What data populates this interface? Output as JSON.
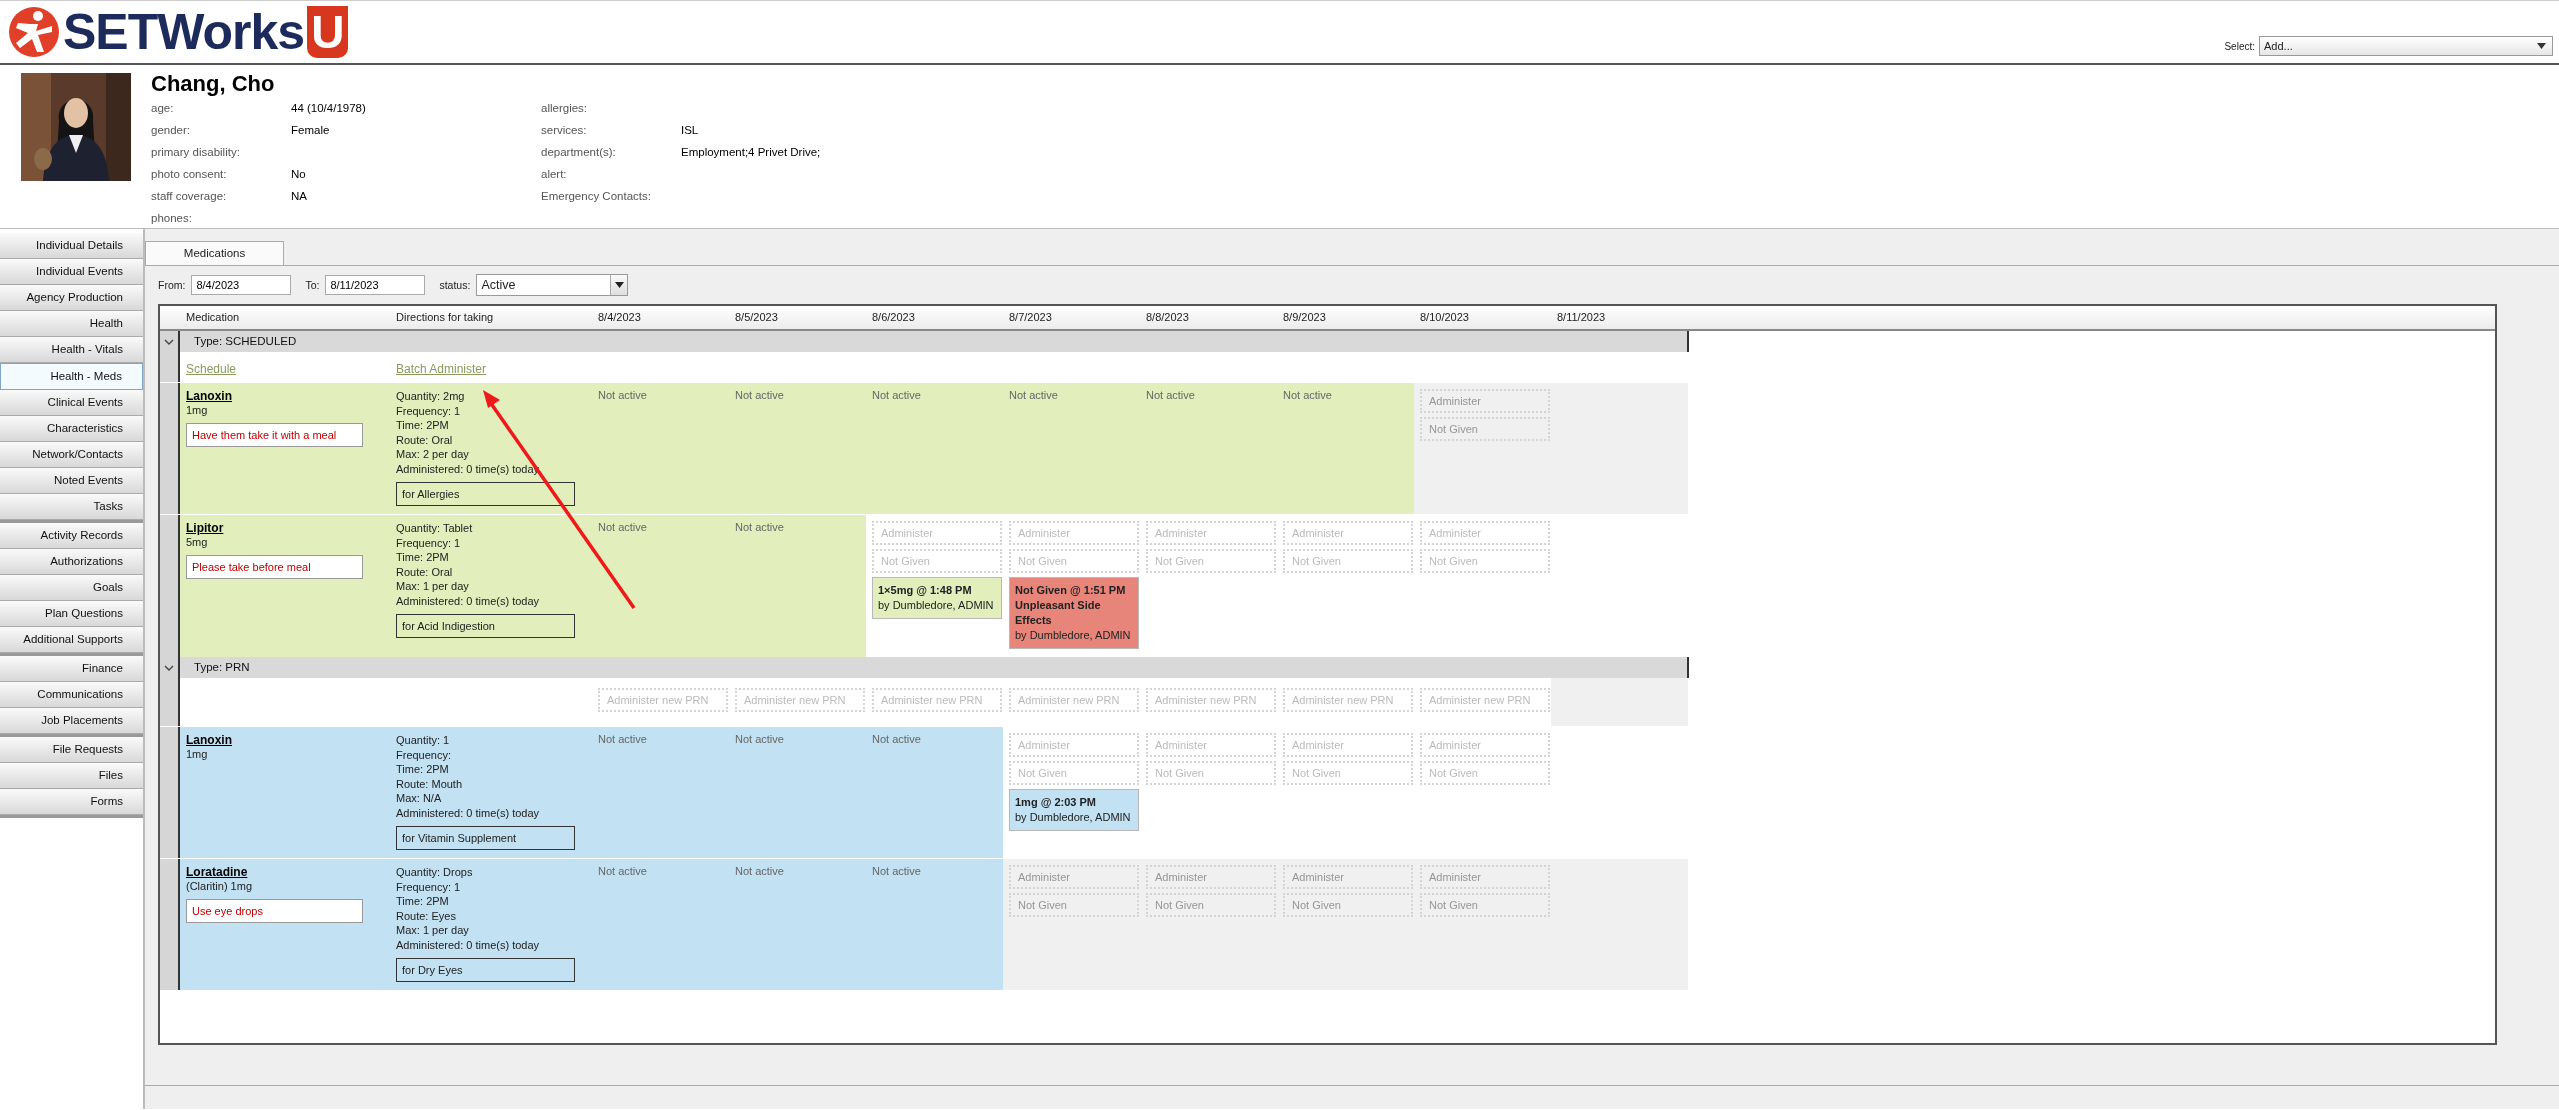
{
  "logo": {
    "text": "SETWorks",
    "badge": "U"
  },
  "top_select": {
    "label": "Select:",
    "value": "Add..."
  },
  "profile": {
    "name": "Chang, Cho",
    "fields_left": [
      {
        "label": "age:",
        "value": "44 (10/4/1978)"
      },
      {
        "label": "gender:",
        "value": "Female"
      },
      {
        "label": "primary disability:"
      },
      {
        "label": "photo consent:",
        "value": "No"
      },
      {
        "label": "staff coverage:",
        "value": "NA"
      },
      {
        "label": "phones:"
      }
    ],
    "fields_right": [
      {
        "label": "allergies:"
      },
      {
        "label": "services:",
        "value": "ISL"
      },
      {
        "label": "department(s):",
        "value": "Employment;4 Privet Drive;"
      },
      {
        "label": "alert:"
      },
      {
        "label": "Emergency Contacts:"
      }
    ]
  },
  "sidebar": {
    "groups": [
      {
        "items": [
          {
            "label": "Individual Details",
            "selected": false
          },
          {
            "label": "Individual Events",
            "selected": false
          },
          {
            "label": "Agency Production",
            "selected": false
          },
          {
            "label": "Health",
            "selected": false
          },
          {
            "label": "Health - Vitals",
            "selected": false
          },
          {
            "label": "Health - Meds",
            "selected": true
          },
          {
            "label": "Clinical Events",
            "selected": false
          },
          {
            "label": "Characteristics",
            "selected": false
          },
          {
            "label": "Network/Contacts",
            "selected": false
          },
          {
            "label": "Noted Events",
            "selected": false
          },
          {
            "label": "Tasks",
            "selected": false
          }
        ]
      },
      {
        "items": [
          {
            "label": "Activity Records",
            "selected": false
          },
          {
            "label": "Authorizations",
            "selected": false
          },
          {
            "label": "Goals",
            "selected": false
          },
          {
            "label": "Plan Questions",
            "selected": false
          },
          {
            "label": "Additional Supports",
            "selected": false
          }
        ]
      },
      {
        "items": [
          {
            "label": "Finance",
            "selected": false
          },
          {
            "label": "Communications",
            "selected": false
          },
          {
            "label": "Job Placements",
            "selected": false
          }
        ]
      },
      {
        "items": [
          {
            "label": "File Requests",
            "selected": false
          },
          {
            "label": "Files",
            "selected": false
          },
          {
            "label": "Forms",
            "selected": false
          }
        ]
      }
    ]
  },
  "tabs": [
    {
      "label": "Medications",
      "selected": true
    }
  ],
  "filters": {
    "from": {
      "label": "From:",
      "value": "8/4/2023"
    },
    "to": {
      "label": "To:",
      "value": "8/11/2023"
    },
    "status": {
      "label": "status:",
      "value": "Active"
    }
  },
  "table": {
    "columns": [
      "Medication",
      "Directions for taking",
      "8/4/2023",
      "8/5/2023",
      "8/6/2023",
      "8/7/2023",
      "8/8/2023",
      "8/9/2023",
      "8/10/2023",
      "8/11/2023"
    ],
    "groups": [
      {
        "kind": "scheduled",
        "title": "Type: SCHEDULED",
        "expanded": true,
        "extra": {
          "kind": "links",
          "links": [
            "Schedule",
            "Batch Administer"
          ]
        },
        "rows": [
          {
            "name": "Lanoxin",
            "strength": "1mg",
            "note": "Have them take it with a meal",
            "directions": [
              "Quantity: 2mg",
              "Frequency: 1",
              "Time: 2PM",
              "Route: Oral",
              "Max: 2 per day",
              "Administered: 0 time(s) today"
            ],
            "purpose": "for Allergies",
            "days": [
              {
                "kind": "not_active",
                "text": "Not active"
              },
              {
                "kind": "not_active",
                "text": "Not active"
              },
              {
                "kind": "not_active",
                "text": "Not active"
              },
              {
                "kind": "not_active",
                "text": "Not active"
              },
              {
                "kind": "not_active",
                "text": "Not active"
              },
              {
                "kind": "not_active",
                "text": "Not active"
              },
              {
                "kind": "actions",
                "disabled": true,
                "buttons": [
                  "Administer",
                  "Not Given"
                ]
              },
              {
                "kind": "blank",
                "disabled": true
              }
            ]
          },
          {
            "name": "Lipitor",
            "strength": "5mg",
            "note": "Please take before meal",
            "directions": [
              "Quantity: Tablet",
              "Frequency: 1",
              "Time: 2PM",
              "Route: Oral",
              "Max: 1 per day",
              "Administered: 0 time(s) today"
            ],
            "purpose": "for Acid Indigestion",
            "days": [
              {
                "kind": "not_active",
                "text": "Not active"
              },
              {
                "kind": "not_active",
                "text": "Not active"
              },
              {
                "kind": "actions",
                "disabled": false,
                "buttons": [
                  "Administer",
                  "Not Given"
                ],
                "record": {
                  "kind": "given",
                  "heading": [
                    "1×5mg @ 1:48 PM"
                  ],
                  "by": "by Dumbledore, ADMIN"
                }
              },
              {
                "kind": "actions",
                "disabled": false,
                "buttons": [
                  "Administer",
                  "Not Given"
                ],
                "record": {
                  "kind": "not_given",
                  "heading": [
                    "Not Given @ 1:51 PM",
                    "Unpleasant Side Effects"
                  ],
                  "by": "by Dumbledore, ADMIN"
                }
              },
              {
                "kind": "actions",
                "disabled": false,
                "buttons": [
                  "Administer",
                  "Not Given"
                ]
              },
              {
                "kind": "actions",
                "disabled": false,
                "buttons": [
                  "Administer",
                  "Not Given"
                ]
              },
              {
                "kind": "actions",
                "disabled": false,
                "buttons": [
                  "Administer",
                  "Not Given"
                ]
              },
              {
                "kind": "blank",
                "disabled": false
              }
            ]
          }
        ]
      },
      {
        "kind": "prn",
        "title": "Type: PRN",
        "expanded": true,
        "extra": {
          "kind": "prn_buttons",
          "cells": [
            {
              "kind": "button",
              "label": "Administer new PRN"
            },
            {
              "kind": "button",
              "label": "Administer new PRN"
            },
            {
              "kind": "button",
              "label": "Administer new PRN"
            },
            {
              "kind": "button",
              "label": "Administer new PRN"
            },
            {
              "kind": "button",
              "label": "Administer new PRN"
            },
            {
              "kind": "button",
              "label": "Administer new PRN"
            },
            {
              "kind": "button",
              "label": "Administer new PRN"
            },
            {
              "kind": "blank",
              "disabled": true
            }
          ]
        },
        "rows": [
          {
            "name": "Lanoxin",
            "strength": "1mg",
            "directions": [
              "Quantity: 1",
              "Frequency:",
              "Time: 2PM",
              "Route: Mouth",
              "Max: N/A",
              "Administered: 0 time(s) today"
            ],
            "purpose": "for Vitamin Supplement",
            "days": [
              {
                "kind": "not_active",
                "text": "Not active"
              },
              {
                "kind": "not_active",
                "text": "Not active"
              },
              {
                "kind": "not_active",
                "text": "Not active"
              },
              {
                "kind": "actions",
                "disabled": false,
                "buttons": [
                  "Administer",
                  "Not Given"
                ],
                "record": {
                  "kind": "given",
                  "heading": [
                    "1mg @ 2:03 PM"
                  ],
                  "by": "by Dumbledore, ADMIN"
                }
              },
              {
                "kind": "actions",
                "disabled": false,
                "buttons": [
                  "Administer",
                  "Not Given"
                ]
              },
              {
                "kind": "actions",
                "disabled": false,
                "buttons": [
                  "Administer",
                  "Not Given"
                ]
              },
              {
                "kind": "actions",
                "disabled": false,
                "buttons": [
                  "Administer",
                  "Not Given"
                ]
              },
              {
                "kind": "blank",
                "disabled": false
              }
            ]
          },
          {
            "name": "Loratadine",
            "strength": "(Claritin) 1mg",
            "note": "Use eye drops",
            "directions": [
              "Quantity: Drops",
              "Frequency: 1",
              "Time: 2PM",
              "Route: Eyes",
              "Max: 1 per day",
              "Administered: 0 time(s) today"
            ],
            "purpose": "for Dry Eyes",
            "days": [
              {
                "kind": "not_active",
                "text": "Not active"
              },
              {
                "kind": "not_active",
                "text": "Not active"
              },
              {
                "kind": "not_active",
                "text": "Not active"
              },
              {
                "kind": "actions",
                "disabled": true,
                "buttons": [
                  "Administer",
                  "Not Given"
                ]
              },
              {
                "kind": "actions",
                "disabled": true,
                "buttons": [
                  "Administer",
                  "Not Given"
                ]
              },
              {
                "kind": "actions",
                "disabled": true,
                "buttons": [
                  "Administer",
                  "Not Given"
                ]
              },
              {
                "kind": "actions",
                "disabled": true,
                "buttons": [
                  "Administer",
                  "Not Given"
                ]
              },
              {
                "kind": "blank",
                "disabled": true
              }
            ]
          }
        ]
      }
    ]
  },
  "annotations": [
    {
      "kind": "arrow"
    }
  ]
}
